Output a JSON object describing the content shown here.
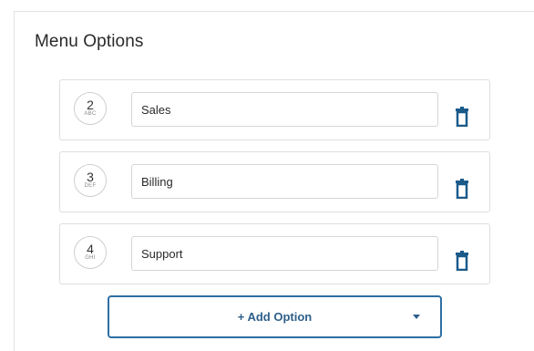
{
  "panel": {
    "title": "Menu Options"
  },
  "options": [
    {
      "digit": "2",
      "letters": "ABC",
      "value": "Sales"
    },
    {
      "digit": "3",
      "letters": "DEF",
      "value": "Billing"
    },
    {
      "digit": "4",
      "letters": "GHI",
      "value": "Support"
    }
  ],
  "add_button": {
    "label": "+ Add Option",
    "icon": "caret-down-icon"
  },
  "icons": {
    "delete": "trash-icon"
  },
  "colors": {
    "accent": "#1a5a8a",
    "border": "#dedede",
    "text": "#2a2a2a"
  }
}
